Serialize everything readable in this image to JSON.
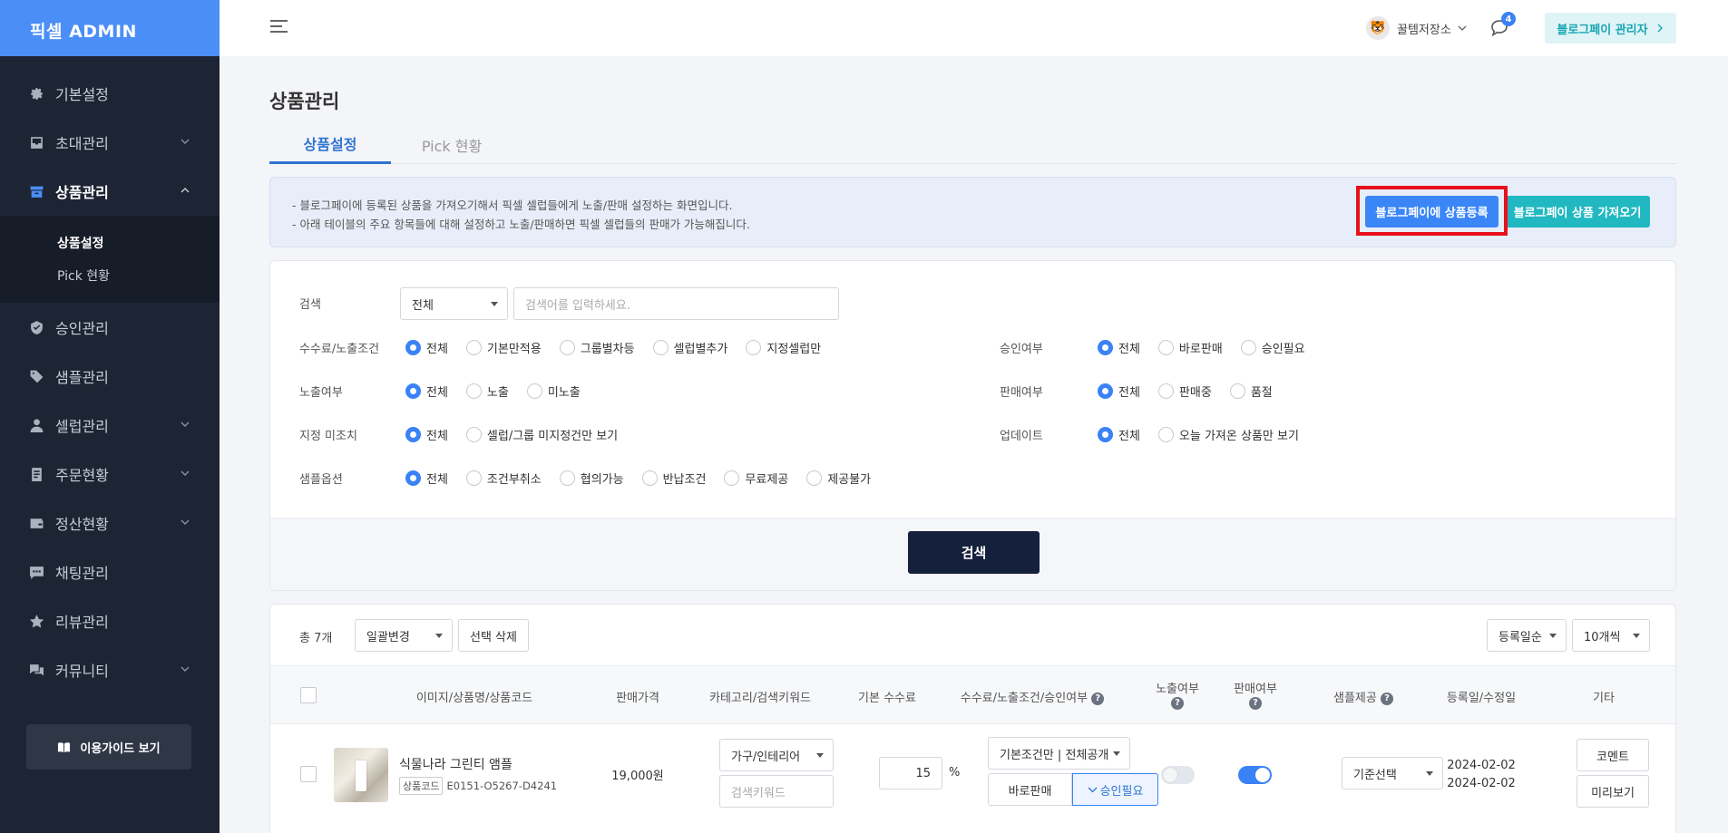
{
  "sidebar": {
    "logo": "픽셀  ADMIN",
    "items": [
      {
        "label": "기본설정",
        "icon": "gear-icon"
      },
      {
        "label": "초대관리",
        "icon": "inbox-icon"
      },
      {
        "label": "상품관리",
        "icon": "box-icon"
      },
      {
        "label": "승인관리",
        "icon": "shield-check-icon"
      },
      {
        "label": "샘플관리",
        "icon": "tag-icon"
      },
      {
        "label": "셀럽관리",
        "icon": "person-icon"
      },
      {
        "label": "주문현황",
        "icon": "document-icon"
      },
      {
        "label": "정산현황",
        "icon": "wallet-icon"
      },
      {
        "label": "채팅관리",
        "icon": "chat-dots-icon"
      },
      {
        "label": "리뷰관리",
        "icon": "star-icon"
      },
      {
        "label": "커뮤니티",
        "icon": "chat-bubbles-icon"
      }
    ],
    "subitems": [
      "상품설정",
      "Pick 현황"
    ],
    "guide_button": "이용가이드 보기"
  },
  "topbar": {
    "user_name": "꿀템저장소",
    "notification_count": "4",
    "admin_button": "블로그페이 관리자"
  },
  "page": {
    "title": "상품관리",
    "tabs": [
      "상품설정",
      "Pick 현황"
    ]
  },
  "info": {
    "line1": "-  블로그페이에 등록된 상품을 가져오기해서 픽셀 셀럽들에게 노출/판매 설정하는 화면입니다.",
    "line2": "-  아래 테이블의 주요 항목들에 대해 설정하고 노출/판매하면 픽셀 셀럽들의 판매가 가능해집니다.",
    "register_button": "블로그페이에 상품등록",
    "import_button": "블로그페이 상품 가져오기"
  },
  "filter": {
    "search_label": "검색",
    "search_select": "전체",
    "search_placeholder": "검색어를 입력하세요.",
    "fee_label": "수수료/노출조건",
    "fee_options": [
      "전체",
      "기본만적용",
      "그룹별차등",
      "셀럽별추가",
      "지정셀럽만"
    ],
    "expose_label": "노출여부",
    "expose_options": [
      "전체",
      "노출",
      "미노출"
    ],
    "unassigned_label": "지정 미조치",
    "unassigned_options": [
      "전체",
      "셀럽/그룹 미지정건만 보기"
    ],
    "sample_label": "샘플옵션",
    "sample_options": [
      "전체",
      "조건부취소",
      "협의가능",
      "반납조건",
      "무료제공",
      "제공불가"
    ],
    "approve_label": "승인여부",
    "approve_options": [
      "전체",
      "바로판매",
      "승인필요"
    ],
    "sale_label": "판매여부",
    "sale_options": [
      "전체",
      "판매중",
      "품절"
    ],
    "update_label": "업데이트",
    "update_options": [
      "전체",
      "오늘 가져온 상품만 보기"
    ],
    "search_button": "검색"
  },
  "list": {
    "total": "총 7개",
    "bulk_select": "일괄변경",
    "delete_button": "선택 삭제",
    "sort_select": "등록일순",
    "page_size_select": "10개씩",
    "headers": {
      "product": "이미지/상품명/상품코드",
      "price": "판매가격",
      "category": "카테고리/검색키워드",
      "fee": "기본 수수료",
      "condition": "수수료/노출조건/승인여부",
      "expose": "노출여부",
      "sale": "판매여부",
      "sample": "샘플제공",
      "date": "등록일/수정일",
      "etc": "기타"
    },
    "row": {
      "name": "식물나라 그린티 앰플",
      "code_tag": "상품코드",
      "code": "E0151-O5267-D4241",
      "price": "19,000원",
      "category": "가구/인테리어",
      "keyword_placeholder": "검색키워드",
      "fee": "15",
      "fee_unit": "%",
      "condition": "기본조건만 | 전체공개",
      "direct_sale": "바로판매",
      "need_approval": "승인필요",
      "sample": "기준선택",
      "registered": "2024-02-02",
      "modified": "2024-02-02",
      "comment_button": "코멘트",
      "preview_button": "미리보기"
    }
  },
  "colors": {
    "accent": "#3b82f6",
    "sidebar_bg": "#1d2433",
    "teal": "#21b8c1",
    "dark_button": "#15203c",
    "highlight": "#e8101b"
  }
}
